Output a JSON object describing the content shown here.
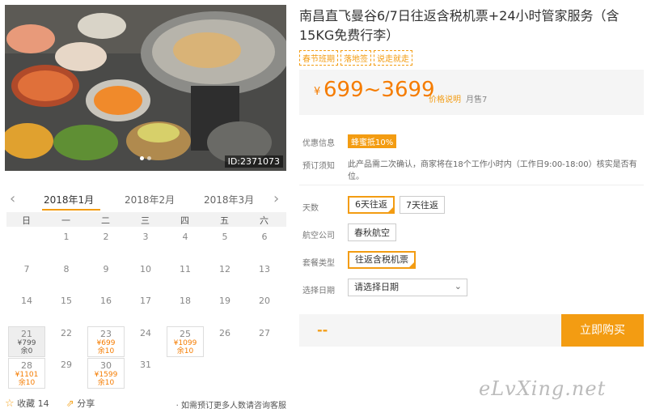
{
  "photo": {
    "id_label": "ID:2371073"
  },
  "calendar": {
    "months": [
      "2018年1月",
      "2018年2月",
      "2018年3月"
    ],
    "prev_icon": "chevron-left-icon",
    "next_icon": "chevron-right-icon",
    "weekdays": [
      "日",
      "一",
      "二",
      "三",
      "四",
      "五",
      "六"
    ],
    "rows": [
      [
        "",
        "1",
        "2",
        "3",
        "4",
        "5",
        "6"
      ],
      [
        "7",
        "8",
        "9",
        "10",
        "11",
        "12",
        "13"
      ],
      [
        "14",
        "15",
        "16",
        "17",
        "18",
        "19",
        "20"
      ],
      [
        "21",
        "22",
        "23",
        "24",
        "25",
        "26",
        "27"
      ],
      [
        "28",
        "29",
        "30",
        "31",
        "",
        "",
        ""
      ]
    ],
    "available": {
      "21": {
        "price": "¥799",
        "remain": "余0"
      },
      "23": {
        "price": "¥699",
        "remain": "余10"
      },
      "25": {
        "price": "¥1099",
        "remain": "余10"
      },
      "28": {
        "price": "¥1101",
        "remain": "余10"
      },
      "30": {
        "price": "¥1599",
        "remain": "余10"
      }
    }
  },
  "footer": {
    "favorite": "收藏 14",
    "share": "分享",
    "note": "如需预订更多人数请咨询客服"
  },
  "product": {
    "title": "南昌直飞曼谷6/7日往返含税机票+24小时管家服务（含15KG免费行李）",
    "tags": [
      "春节班期",
      "落地签",
      "说走就走"
    ],
    "price_currency": "¥",
    "price_range": "699~3699",
    "price_note_link": "价格说明",
    "monthly_sales": "月售7"
  },
  "info": {
    "discount_label": "优惠信息",
    "discount_badge": "蜂蜜抵10%",
    "notice_label": "预订须知",
    "notice_text": "此产品需二次确认，商家将在18个工作小时内（工作日9:00-18:00）核实是否有位。"
  },
  "options": {
    "days_label": "天数",
    "days": [
      "6天往返",
      "7天往返"
    ],
    "airline_label": "航空公司",
    "airline": "春秋航空",
    "package_label": "套餐类型",
    "package": "往返含税机票",
    "date_label": "选择日期",
    "date_placeholder": "请选择日期"
  },
  "buy": {
    "total": "--",
    "button": "立即购买"
  },
  "watermark": "eLvXing.net",
  "colors": {
    "accent": "#f39c12",
    "price": "#f57c00"
  }
}
